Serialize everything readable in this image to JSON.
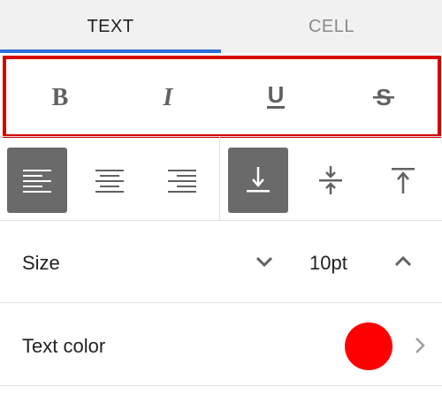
{
  "tabs": [
    {
      "label": "TEXT",
      "active": true
    },
    {
      "label": "CELL",
      "active": false
    }
  ],
  "colors": {
    "accent": "#2f6fdb",
    "highlight_border": "#d60000",
    "selected_button": "#6a6a6a",
    "icon": "#616161",
    "text_color_swatch": "#ff0000"
  },
  "format_buttons": [
    {
      "name": "bold",
      "glyph": "B",
      "icon": "bold-icon"
    },
    {
      "name": "italic",
      "glyph": "I",
      "icon": "italic-icon"
    },
    {
      "name": "underline",
      "glyph": "U",
      "icon": "underline-icon"
    },
    {
      "name": "strikethrough",
      "glyph": "S",
      "icon": "strikethrough-icon"
    }
  ],
  "horizontal_alignment": {
    "options": [
      "align-left",
      "align-center",
      "align-right"
    ],
    "selected": "align-left"
  },
  "vertical_alignment": {
    "options": [
      "align-bottom",
      "align-middle",
      "align-top"
    ],
    "selected": "align-bottom"
  },
  "size": {
    "label": "Size",
    "value": "10pt"
  },
  "text_color": {
    "label": "Text color",
    "value": "#ff0000"
  }
}
